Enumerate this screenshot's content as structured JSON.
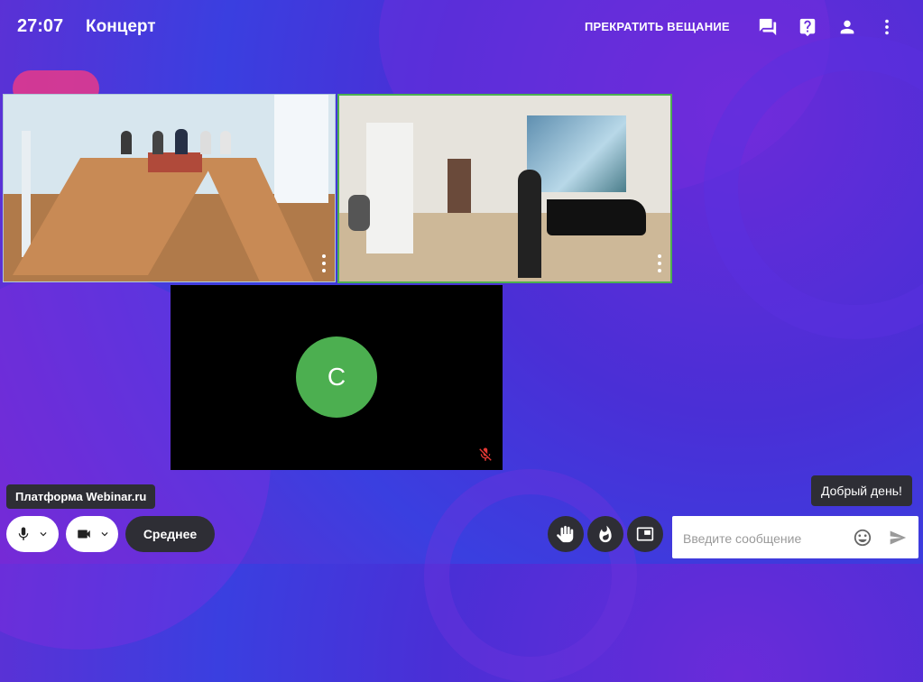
{
  "header": {
    "time": "27:07",
    "title": "Концерт",
    "stop_broadcast_label": "ПРЕКРАТИТЬ ВЕЩАНИЕ",
    "icons": [
      "chat-icon",
      "help-icon",
      "participants-icon",
      "more-vert-icon"
    ]
  },
  "video_tiles": [
    {
      "id": "tile-1",
      "kind": "camera",
      "scene": "classroom"
    },
    {
      "id": "tile-2",
      "kind": "camera",
      "scene": "hall",
      "active_speaker": true
    },
    {
      "id": "tile-3",
      "kind": "avatar",
      "initial": "С",
      "mic_muted": true
    }
  ],
  "tooltips": {
    "platform": "Платформа Webinar.ru",
    "greeting": "Добрый день!"
  },
  "controls": {
    "mic_icon": "microphone-icon",
    "camera_icon": "videocam-icon",
    "quality_label": "Среднее",
    "raise_hand_icon": "raise-hand-icon",
    "reaction_icon": "fire-icon",
    "pip_icon": "picture-in-picture-icon"
  },
  "chat": {
    "placeholder": "Введите сообщение",
    "value": ""
  },
  "colors": {
    "active_border": "#4caf50",
    "avatar_bg": "#4caf50",
    "dark_button": "#2e2e35",
    "muted_mic": "#e53935"
  }
}
